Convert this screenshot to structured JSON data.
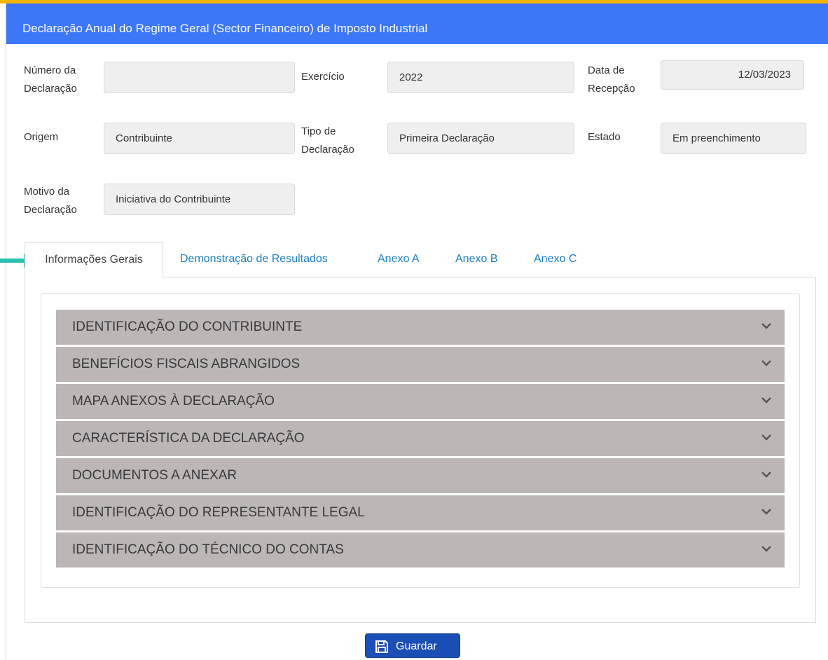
{
  "header": {
    "title": "Declaração Anual do Regime Geral (Sector Financeiro) de Imposto Industrial"
  },
  "form": {
    "numero": {
      "label_1": "Número da",
      "label_2": "Declaração",
      "value": ""
    },
    "exercicio": {
      "label": "Exercício",
      "value": "2022"
    },
    "data_recepcao": {
      "label_1": "Data de",
      "label_2": "Recepção",
      "value": "12/03/2023"
    },
    "origem": {
      "label": "Origem",
      "value": "Contribuinte"
    },
    "tipo": {
      "label_1": "Tipo de",
      "label_2": "Declaração",
      "value": "Primeira Declaração"
    },
    "estado": {
      "label": "Estado",
      "value": "Em preenchimento"
    },
    "motivo": {
      "label_1": "Motivo da",
      "label_2": "Declaração",
      "value": "Iniciativa do Contribuinte"
    }
  },
  "tabs": [
    {
      "label": "Informações Gerais",
      "active": true
    },
    {
      "label": "Demonstração de Resultados",
      "active": false
    },
    {
      "label": "Anexo A",
      "active": false
    },
    {
      "label": "Anexo B",
      "active": false
    },
    {
      "label": "Anexo C",
      "active": false
    }
  ],
  "sections": [
    {
      "label": "IDENTIFICAÇÃO DO CONTRIBUINTE"
    },
    {
      "label": "BENEFÍCIOS FISCAIS ABRANGIDOS"
    },
    {
      "label": "MAPA ANEXOS À DECLARAÇÃO"
    },
    {
      "label": "CARACTERÍSTICA DA DECLARAÇÃO"
    },
    {
      "label": "DOCUMENTOS A ANEXAR"
    },
    {
      "label": "IDENTIFICAÇÃO DO REPRESENTANTE LEGAL"
    },
    {
      "label": "IDENTIFICAÇÃO DO TÉCNICO DO CONTAS"
    }
  ],
  "actions": {
    "save_label": "Guardar",
    "save_icon": "floppy-disk-icon"
  },
  "colors": {
    "header": "#3b77f7",
    "accent_stripe": "#f5b400",
    "tab_link": "#1a7fc4",
    "accordion": "#bdb6b6",
    "save_button": "#1b4fb5",
    "pointer": "#2bbfae"
  }
}
